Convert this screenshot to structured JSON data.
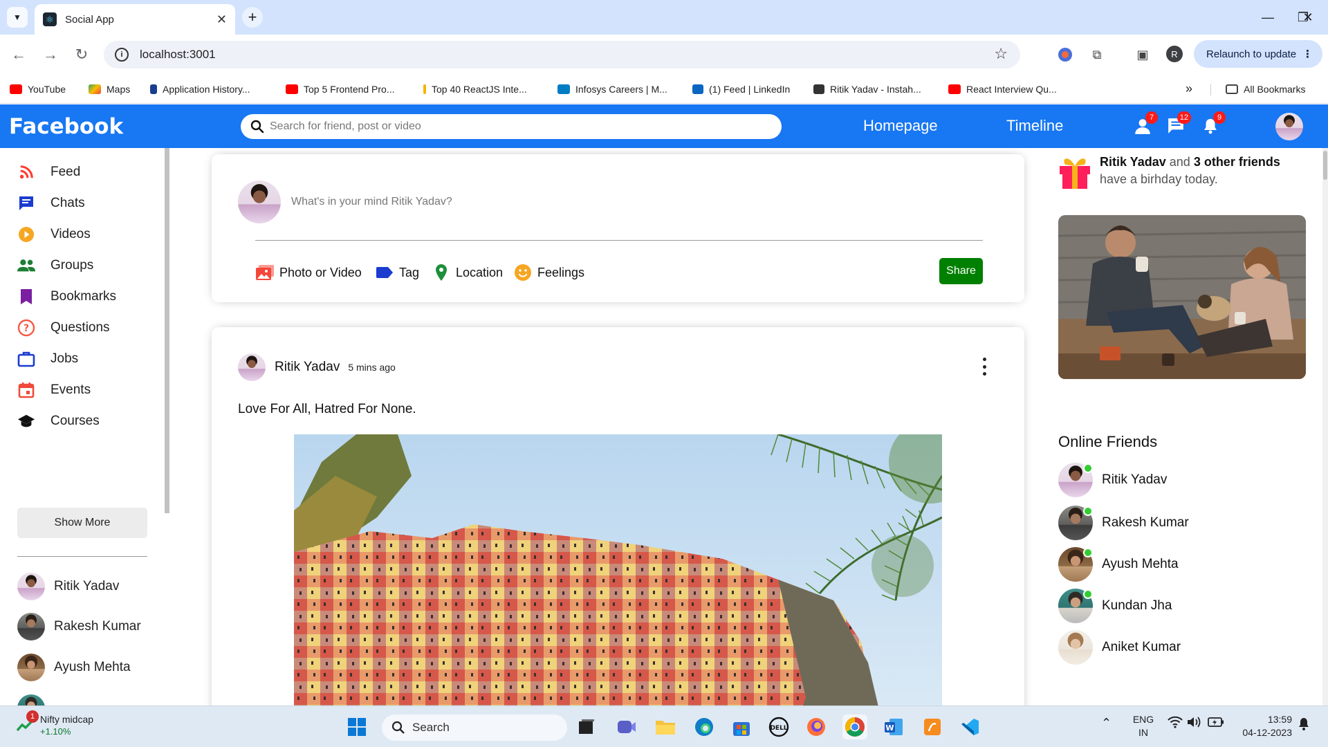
{
  "browser": {
    "tab_title": "Social App",
    "url": "localhost:3001",
    "relaunch_label": "Relaunch to update",
    "profile_initial": "R",
    "bookmarks": [
      {
        "label": "YouTube",
        "color": "#ff0000"
      },
      {
        "label": "Maps",
        "color": "#34a853"
      },
      {
        "label": "Application History...",
        "color": "#1a3d8f"
      },
      {
        "label": "Top 5 Frontend Pro...",
        "color": "#ff0000"
      },
      {
        "label": "Top 40 ReactJS Inte...",
        "color": "#f4b400"
      },
      {
        "label": "Infosys Careers | M...",
        "color": "#007cc3"
      },
      {
        "label": "(1) Feed | LinkedIn",
        "color": "#0a66c2"
      },
      {
        "label": "Ritik Yadav - Instah...",
        "color": "#333333"
      },
      {
        "label": "React Interview Qu...",
        "color": "#ff0000"
      }
    ],
    "all_bookmarks_label": "All Bookmarks"
  },
  "header": {
    "logo": "Facebook",
    "search_placeholder": "Search for friend, post or video",
    "links": [
      "Homepage",
      "Timeline"
    ],
    "badges": {
      "friends": "7",
      "messages": "12",
      "notifications": "9"
    },
    "brand_color": "#1877f2"
  },
  "sidebar": {
    "items": [
      {
        "label": "Feed",
        "icon": "rss-icon",
        "color": "#ff3b30"
      },
      {
        "label": "Chats",
        "icon": "chat-icon",
        "color": "#1a3ccf"
      },
      {
        "label": "Videos",
        "icon": "play-circle-icon",
        "color": "#f5a623"
      },
      {
        "label": "Groups",
        "icon": "group-icon",
        "color": "#1e7e34"
      },
      {
        "label": "Bookmarks",
        "icon": "bookmark-icon",
        "color": "#7a1fa2"
      },
      {
        "label": "Questions",
        "icon": "help-circle-icon",
        "color": "#f45b45"
      },
      {
        "label": "Jobs",
        "icon": "briefcase-icon",
        "color": "#1a3ccf"
      },
      {
        "label": "Events",
        "icon": "calendar-icon",
        "color": "#f04a3a"
      },
      {
        "label": "Courses",
        "icon": "graduation-cap-icon",
        "color": "#111111"
      }
    ],
    "show_more_label": "Show More",
    "friends": [
      "Ritik Yadav",
      "Rakesh Kumar",
      "Ayush Mehta"
    ]
  },
  "share": {
    "placeholder": "What's in your mind Ritik Yadav?",
    "options": [
      {
        "label": "Photo or Video",
        "icon": "photo-icon",
        "color": "#f4473a"
      },
      {
        "label": "Tag",
        "icon": "tag-icon",
        "color": "#1a3ccf"
      },
      {
        "label": "Location",
        "icon": "location-pin-icon",
        "color": "#1e8f3a"
      },
      {
        "label": "Feelings",
        "icon": "smiley-icon",
        "color": "#f5a623"
      }
    ],
    "share_label": "Share"
  },
  "post": {
    "user": "Ritik Yadav",
    "time": "5 mins ago",
    "text": "Love For All, Hatred For None."
  },
  "rightbar": {
    "birthday": {
      "name": "Ritik Yadav",
      "connector": "and",
      "others": "3 other friends",
      "rest": "have a birhday today."
    },
    "online_title": "Online Friends",
    "online_friends": [
      "Ritik Yadav",
      "Rakesh Kumar",
      "Ayush Mehta",
      "Kundan Jha",
      "Aniket Kumar"
    ]
  },
  "taskbar": {
    "widget_title": "Nifty midcap",
    "widget_value": "+1.10%",
    "widget_badge": "1",
    "search_label": "Search",
    "lang_top": "ENG",
    "lang_bottom": "IN",
    "time": "13:59",
    "date": "04-12-2023"
  }
}
